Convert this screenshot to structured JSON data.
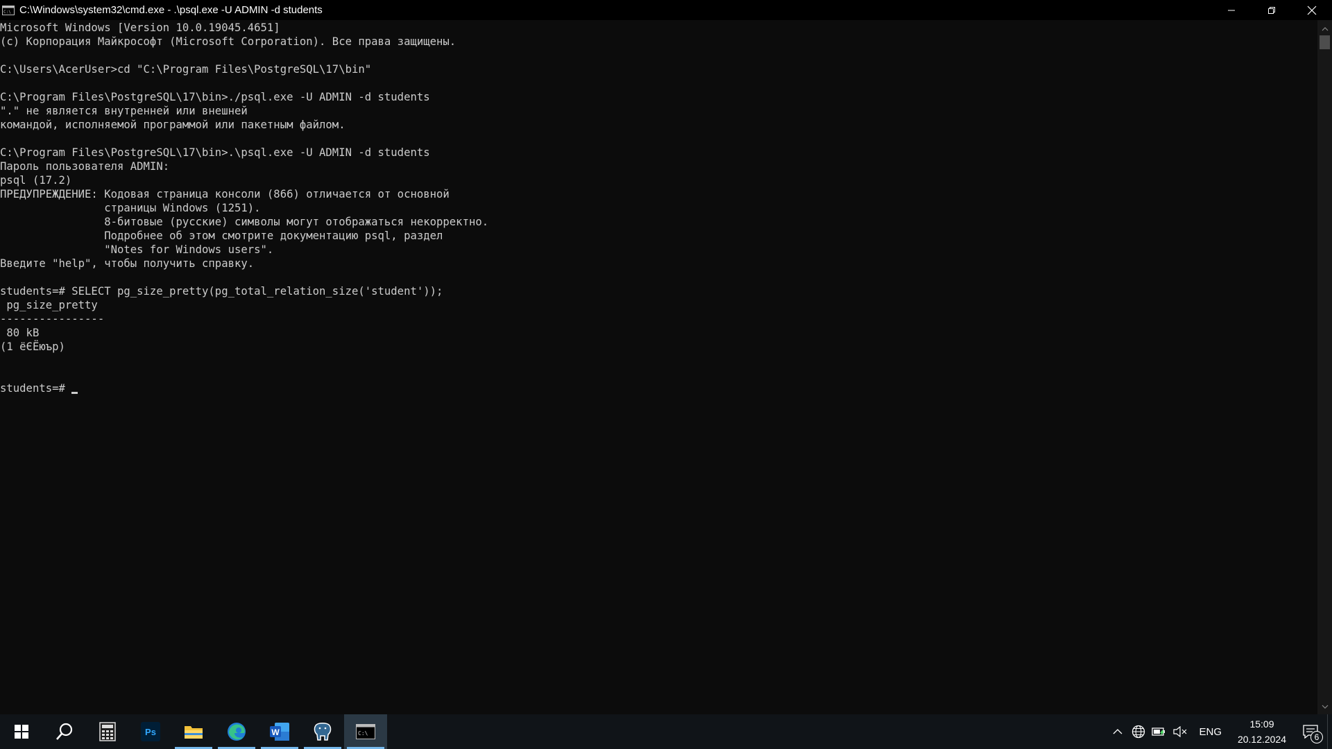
{
  "window": {
    "title": "C:\\Windows\\system32\\cmd.exe - .\\psql.exe  -U ADMIN -d students",
    "icon": "cmd-icon"
  },
  "console": {
    "lines": [
      "Microsoft Windows [Version 10.0.19045.4651]",
      "(c) Корпорация Майкрософт (Microsoft Corporation). Все права защищены.",
      "",
      "C:\\Users\\AcerUser>cd \"C:\\Program Files\\PostgreSQL\\17\\bin\"",
      "",
      "C:\\Program Files\\PostgreSQL\\17\\bin>./psql.exe -U ADMIN -d students",
      "\".\" не является внутренней или внешней",
      "командой, исполняемой программой или пакетным файлом.",
      "",
      "C:\\Program Files\\PostgreSQL\\17\\bin>.\\psql.exe -U ADMIN -d students",
      "Пароль пользователя ADMIN:",
      "psql (17.2)",
      "ПРЕДУПРЕЖДЕНИЕ: Кодовая страница консоли (866) отличается от основной",
      "                страницы Windows (1251).",
      "                8-битовые (русские) символы могут отображаться некорректно.",
      "                Подробнее об этом смотрите документацию psql, раздел",
      "                \"Notes for Windows users\".",
      "Введите \"help\", чтобы получить справку.",
      "",
      "students=# SELECT pg_size_pretty(pg_total_relation_size('student'));",
      " pg_size_pretty",
      "----------------",
      " 80 kB",
      "(1 ёЄЁюър)",
      "",
      ""
    ],
    "prompt": "students=#"
  },
  "taskbar": {
    "apps": [
      {
        "name": "start",
        "icon": "windows-logo-icon"
      },
      {
        "name": "search",
        "icon": "search-icon"
      },
      {
        "name": "calculator",
        "icon": "calculator-icon"
      },
      {
        "name": "photoshop",
        "icon": "photoshop-icon",
        "label": "Ps"
      },
      {
        "name": "file-explorer",
        "icon": "folder-icon"
      },
      {
        "name": "edge",
        "icon": "edge-icon"
      },
      {
        "name": "word",
        "icon": "word-icon",
        "label": "W"
      },
      {
        "name": "pgadmin",
        "icon": "elephant-icon"
      },
      {
        "name": "cmd",
        "icon": "terminal-icon"
      }
    ],
    "tray": {
      "language": "ENG",
      "time": "15:09",
      "date": "20.12.2024",
      "notification_count": "6"
    }
  },
  "colors": {
    "console_bg": "#0c0c0c",
    "console_fg": "#cccccc",
    "taskbar_bg": "#101418",
    "running_indicator": "#76b9ed"
  }
}
